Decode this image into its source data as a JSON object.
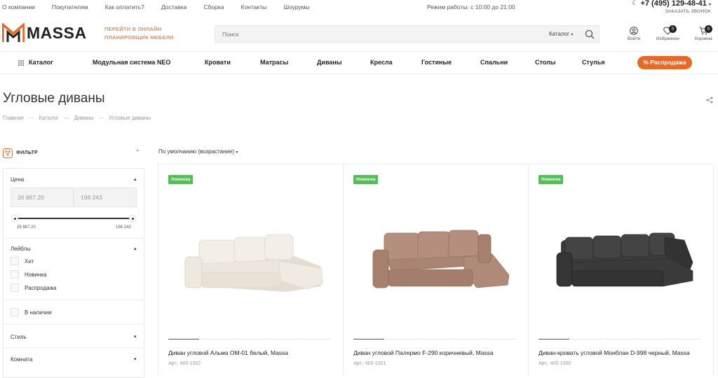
{
  "topbar": {
    "links": [
      "О компании",
      "Покупателям",
      "Как оплатить?",
      "Доставка",
      "Сборка",
      "Контакты",
      "Шоурумы"
    ],
    "hours": "Режим работы: с 10:00 до 21:00",
    "phone": "+7 (495) 129-48-41",
    "callback": "ЗАКАЗАТЬ ЗВОНОК"
  },
  "header": {
    "logo_text": "MASSA",
    "promo_line1": "ПЕРЕЙТИ В ОНЛАЙН",
    "promo_line2": "ПЛАНИРОВЩИК МЕБЕЛИ",
    "search_placeholder": "Поиск",
    "search_scope": "Каталог",
    "login_label": "Войти",
    "favorites_label": "Избранное",
    "favorites_count": "0",
    "cart_label": "Корзина",
    "cart_count": "0"
  },
  "nav": {
    "catalog": "Каталог",
    "items": [
      "Модульная система NEO",
      "Кровати",
      "Матрасы",
      "Диваны",
      "Кресла",
      "Гостиные",
      "Спальни",
      "Столы",
      "Стулья"
    ],
    "sale": "% Распродажа"
  },
  "page": {
    "title": "Угловые диваны",
    "breadcrumbs": [
      "Главная",
      "Каталог",
      "Диваны",
      "Угловые диваны"
    ]
  },
  "filter": {
    "title": "ФИЛЬТР",
    "price_title": "Цена",
    "price_min": "26 867.20",
    "price_max": "198 243",
    "range_min_label": "26 867.20",
    "range_max_label": "198 243",
    "labels_title": "Лейблы",
    "labels": [
      "Хит",
      "Новинка",
      "Распродажа"
    ],
    "in_stock": "В наличии",
    "style_title": "Стиль",
    "room_title": "Комната"
  },
  "sort": {
    "label": "По умолчанию (возрастание)"
  },
  "products": [
    {
      "badge": "Новинка",
      "name": "Диван угловой Альма ОМ-01 белый, Massa",
      "article": "Арт.: 405-1002",
      "color": "#ece7dc"
    },
    {
      "badge": "Новинка",
      "name": "Диван угловой Палермо F-290 коричневый, Massa",
      "article": "Арт.: 405-1001",
      "color": "#b08a78"
    },
    {
      "badge": "Новинка",
      "name": "Диван-кровать угловой Монблан D-998 черный, Massa",
      "article": "Арт.: 405-1000",
      "color": "#3a3a3a"
    }
  ],
  "colors": {
    "accent": "#e36a2b",
    "promo": "#ec8b5e",
    "badge_new": "#5cb85c"
  }
}
